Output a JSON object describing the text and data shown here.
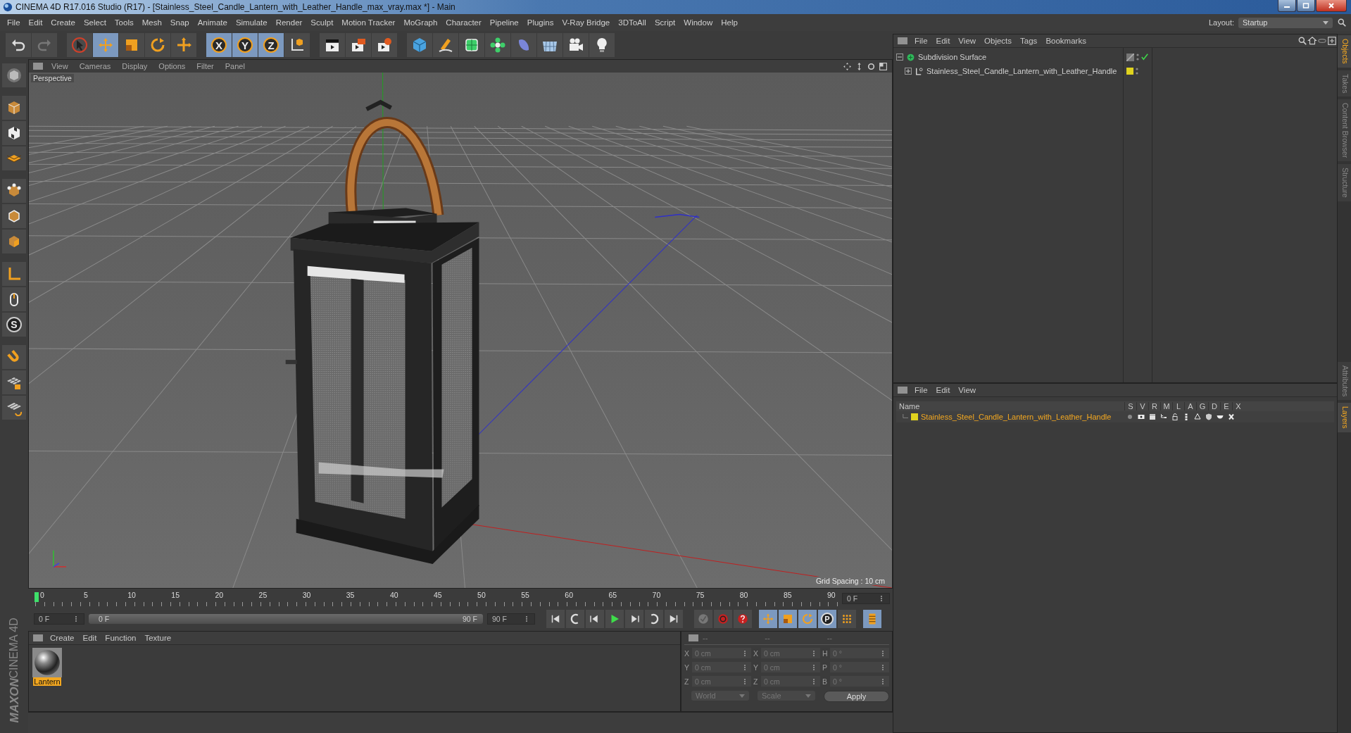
{
  "window": {
    "title": "CINEMA 4D R17.016 Studio (R17) - [Stainless_Steel_Candle_Lantern_with_Leather_Handle_max_vray.max *] - Main"
  },
  "menu": [
    "File",
    "Edit",
    "Create",
    "Select",
    "Tools",
    "Mesh",
    "Snap",
    "Animate",
    "Simulate",
    "Render",
    "Sculpt",
    "Motion Tracker",
    "MoGraph",
    "Character",
    "Pipeline",
    "Plugins",
    "V-Ray Bridge",
    "3DToAll",
    "Script",
    "Window",
    "Help"
  ],
  "layout": {
    "label": "Layout:",
    "value": "Startup"
  },
  "toolbar": [
    {
      "kind": "undo",
      "selected": false
    },
    {
      "kind": "redo",
      "selected": false
    },
    {
      "kind": "select",
      "selected": false
    },
    {
      "kind": "move",
      "selected": true
    },
    {
      "kind": "scale",
      "selected": false
    },
    {
      "kind": "rotate",
      "selected": false
    },
    {
      "kind": "transform",
      "selected": false
    },
    {
      "kind": "axis",
      "label": "X",
      "selected": true
    },
    {
      "kind": "axis",
      "label": "Y",
      "selected": true
    },
    {
      "kind": "axis",
      "label": "Z",
      "selected": true
    },
    {
      "kind": "coords",
      "selected": false
    },
    {
      "kind": "render-view",
      "selected": false
    },
    {
      "kind": "render-picture",
      "selected": false
    },
    {
      "kind": "render-settings",
      "selected": false
    },
    {
      "kind": "cube",
      "selected": false
    },
    {
      "kind": "pen",
      "selected": false
    },
    {
      "kind": "subdivide",
      "selected": false
    },
    {
      "kind": "cloner",
      "selected": false
    },
    {
      "kind": "deformer",
      "selected": false
    },
    {
      "kind": "floor",
      "selected": false
    },
    {
      "kind": "camera",
      "selected": false
    },
    {
      "kind": "light",
      "selected": false
    }
  ],
  "side_tools": [
    {
      "kind": "model"
    },
    {
      "kind": "box"
    },
    {
      "kind": "checker"
    },
    {
      "kind": "layers"
    },
    {
      "kind": "points"
    },
    {
      "kind": "edges"
    },
    {
      "kind": "polygons"
    },
    {
      "kind": "axis-l"
    },
    {
      "kind": "mouse"
    },
    {
      "kind": "snap",
      "label": "S"
    },
    {
      "kind": "magnet"
    },
    {
      "kind": "lock-grid"
    },
    {
      "kind": "grid-rotate"
    }
  ],
  "viewport": {
    "menu": [
      "View",
      "Cameras",
      "Display",
      "Options",
      "Filter",
      "Panel"
    ],
    "camera": "Perspective",
    "grid_spacing": "Grid Spacing : 10 cm"
  },
  "timeline": {
    "ticks": [
      "0",
      "5",
      "10",
      "15",
      "20",
      "25",
      "30",
      "35",
      "40",
      "45",
      "50",
      "55",
      "60",
      "65",
      "70",
      "75",
      "80",
      "85",
      "90"
    ],
    "level": 0,
    "current": "0 F",
    "start": "0 F",
    "range": {
      "start": "0 F",
      "end": "90 F",
      "level": 1
    },
    "end": "90 F",
    "transport": [
      {
        "kind": "first"
      },
      {
        "kind": "prev-key"
      },
      {
        "kind": "prev-frame"
      },
      {
        "kind": "play"
      },
      {
        "kind": "next-frame"
      },
      {
        "kind": "next-key"
      },
      {
        "kind": "last"
      }
    ],
    "keys": [
      {
        "kind": "record",
        "selected": false
      },
      {
        "kind": "autokey",
        "selected": false
      },
      {
        "kind": "key-help",
        "selected": false
      },
      {
        "kind": "move",
        "selected": true
      },
      {
        "kind": "scale",
        "selected": true
      },
      {
        "kind": "rotate",
        "selected": true
      },
      {
        "kind": "param",
        "label": "P",
        "selected": true
      },
      {
        "kind": "pla",
        "selected": false
      },
      {
        "kind": "timeline",
        "selected": true
      }
    ]
  },
  "materials": {
    "menu": [
      "Create",
      "Edit",
      "Function",
      "Texture"
    ],
    "items": [
      {
        "name": "Lantern",
        "selected": true
      }
    ]
  },
  "coordinates": {
    "headers": [
      "--",
      "--",
      "--"
    ],
    "rows": [
      [
        {
          "axis": "X",
          "value": "0 cm"
        },
        {
          "axis": "X",
          "value": "0 cm"
        },
        {
          "axis": "H",
          "value": "0 °"
        }
      ],
      [
        {
          "axis": "Y",
          "value": "0 cm"
        },
        {
          "axis": "Y",
          "value": "0 cm"
        },
        {
          "axis": "P",
          "value": "0 °"
        }
      ],
      [
        {
          "axis": "Z",
          "value": "0 cm"
        },
        {
          "axis": "Z",
          "value": "0 cm"
        },
        {
          "axis": "B",
          "value": "0 °"
        }
      ]
    ],
    "mode": "World",
    "transform": "Scale",
    "apply": "Apply"
  },
  "objects": {
    "menu": [
      "File",
      "Edit",
      "View",
      "Objects",
      "Tags",
      "Bookmarks"
    ],
    "tree": [
      {
        "name": "Subdivision Surface",
        "expanded": true,
        "enabled": true,
        "children": [
          {
            "name": "Stainless_Steel_Candle_Lantern_with_Leather_Handle",
            "expanded": false,
            "color": "#e0d31e"
          }
        ]
      }
    ]
  },
  "layers": {
    "menu": [
      "File",
      "Edit",
      "View"
    ],
    "columns": [
      "Name",
      "S",
      "V",
      "R",
      "M",
      "L",
      "A",
      "G",
      "D",
      "E",
      "X"
    ],
    "items": [
      {
        "name": "Stainless_Steel_Candle_Lantern_with_Leather_Handle",
        "color": "#e0d31e"
      }
    ]
  },
  "side_tabs": [
    {
      "label": "Objects",
      "selected": true
    },
    {
      "label": "Takes",
      "selected": false
    },
    {
      "label": "Content Browser",
      "selected": false
    },
    {
      "label": "Structure",
      "selected": false
    }
  ],
  "side_tabs_lower": [
    {
      "label": "Attributes",
      "selected": false
    },
    {
      "label": "Layers",
      "selected": true
    }
  ],
  "brand": {
    "line1": "MAXON",
    "line2": "CINEMA 4D"
  }
}
